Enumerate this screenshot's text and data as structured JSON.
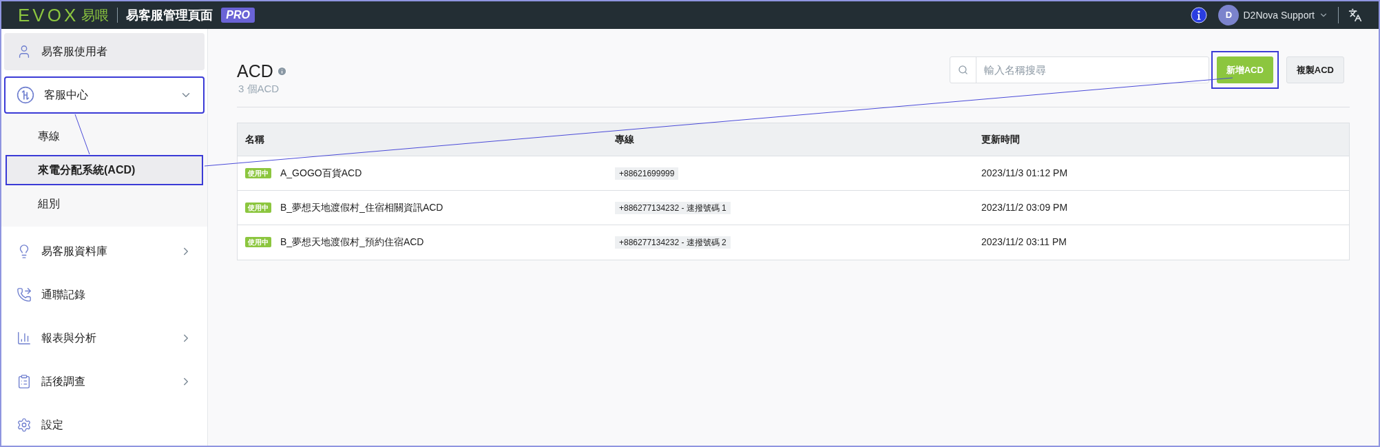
{
  "header": {
    "logo": "EVOX",
    "logo_suffix": "易喂",
    "title": "易客服管理頁面",
    "badge": "PRO",
    "avatar": "D",
    "user": "D2Nova Support"
  },
  "sidebar": {
    "items": [
      {
        "label": "易客服使用者",
        "selected": true,
        "highlighted": false,
        "expandable": false
      },
      {
        "label": "客服中心",
        "selected": false,
        "highlighted": true,
        "expandable": true,
        "expanded": true,
        "children": [
          {
            "label": "專線",
            "selected": false,
            "highlighted": false
          },
          {
            "label": "來電分配系統(ACD)",
            "selected": true,
            "highlighted": true
          },
          {
            "label": "組別",
            "selected": false,
            "highlighted": false
          }
        ]
      },
      {
        "label": "易客服資料庫",
        "selected": false,
        "highlighted": false,
        "expandable": true,
        "expanded": false
      },
      {
        "label": "通聯記錄",
        "selected": false,
        "highlighted": false,
        "expandable": false
      },
      {
        "label": "報表與分析",
        "selected": false,
        "highlighted": false,
        "expandable": true,
        "expanded": false
      },
      {
        "label": "話後調查",
        "selected": false,
        "highlighted": false,
        "expandable": true,
        "expanded": false
      },
      {
        "label": "設定",
        "selected": false,
        "highlighted": false,
        "expandable": false
      }
    ]
  },
  "page": {
    "title": "ACD",
    "count": "3 個ACD",
    "search": {
      "placeholder": "輸入名稱搜尋"
    },
    "buttons": [
      {
        "label": "新增ACD",
        "kind": "primary",
        "highlighted": true
      },
      {
        "label": "複製ACD",
        "kind": "secondary",
        "highlighted": false
      }
    ]
  },
  "table": {
    "columns": [
      "名稱",
      "專線",
      "更新時間"
    ],
    "rows": [
      {
        "status": "使用中",
        "name": "A_GOGO百貨ACD",
        "line": "+88621699999",
        "updated": "2023/11/3 01:12 PM"
      },
      {
        "status": "使用中",
        "name": "B_夢想天地渡假村_住宿相關資訊ACD",
        "line": "+886277134232 - 速撥號碼 1",
        "updated": "2023/11/2 03:09 PM"
      },
      {
        "status": "使用中",
        "name": "B_夢想天地渡假村_預約住宿ACD",
        "line": "+886277134232 - 速撥號碼 2",
        "updated": "2023/11/2 03:11 PM"
      }
    ]
  }
}
